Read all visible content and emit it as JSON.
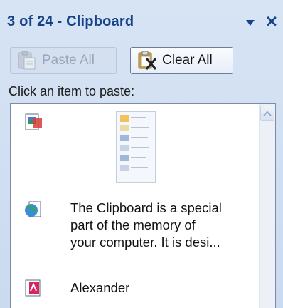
{
  "pane": {
    "title": "3 of 24 - Clipboard",
    "dropdown_icon": "triangle-down-icon",
    "close_label": "×"
  },
  "toolbar": {
    "paste_all_label": "Paste All",
    "paste_all_enabled": false,
    "clear_all_label": "Clear All"
  },
  "hint": "Click an item to paste:",
  "items": [
    {
      "type": "image",
      "icon": "picture-clip-icon",
      "text": ""
    },
    {
      "type": "web-text",
      "icon": "web-document-icon",
      "lines": [
        "The Clipboard is a special",
        "part of the memory of",
        "your computer. It is desi..."
      ]
    },
    {
      "type": "text",
      "icon": "word-document-icon",
      "lines": [
        "Alexander"
      ]
    }
  ],
  "colors": {
    "title": "#15428b",
    "pane_bg": "#cfdcee",
    "list_border": "#7a8ca6"
  }
}
